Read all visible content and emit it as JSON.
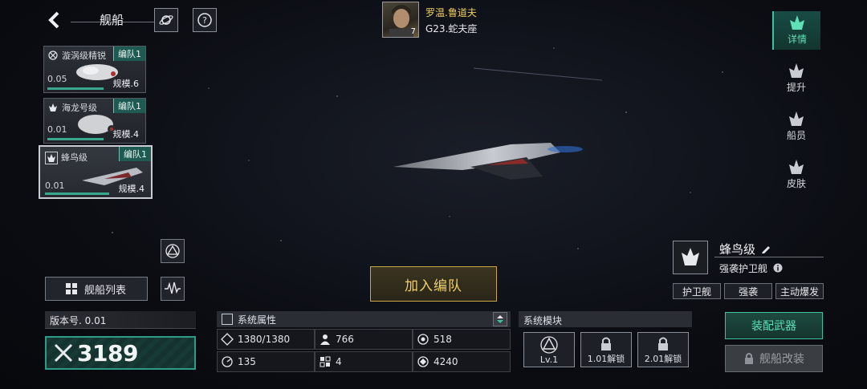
{
  "header": {
    "title": "舰船"
  },
  "commander": {
    "name": "罗温.鲁道夫",
    "location": "G23.蛇夫座",
    "level": "7"
  },
  "ship_cards": [
    {
      "name": "漩涡级精锐",
      "tag": "编队1",
      "version": "0.05",
      "scale": "规模.6"
    },
    {
      "name": "海龙号级",
      "tag": "编队1",
      "version": "0.01",
      "scale": "规模.4"
    },
    {
      "name": "蜂鸟级",
      "tag": "编队1",
      "version": "0.01",
      "scale": "规模.4"
    }
  ],
  "ship_list_label": "舰船列表",
  "version_label": "版本号. 0.01",
  "combat_power": "3189",
  "join_label": "加入编队",
  "system_attr": {
    "title": "系统属性",
    "cells": [
      {
        "icon": "armor-icon",
        "value": "1380/1380"
      },
      {
        "icon": "crew-icon",
        "value": "766"
      },
      {
        "icon": "shield-icon",
        "value": "518"
      },
      {
        "icon": "speed-icon",
        "value": "135"
      },
      {
        "icon": "flag-icon",
        "value": "4"
      },
      {
        "icon": "radar-icon",
        "value": "4240"
      }
    ]
  },
  "system_module": {
    "title": "系统模块",
    "slots": [
      {
        "label": "Lv.1"
      },
      {
        "label": "1.01解锁"
      },
      {
        "label": "2.01解锁"
      }
    ]
  },
  "ship_info": {
    "name": "蜂鸟级",
    "type": "强袭护卫舰",
    "tags": [
      "护卫舰",
      "强袭",
      "主动爆发"
    ]
  },
  "equip_weapon_label": "装配武器",
  "ship_modify_label": "舰船改装",
  "right_nav": [
    {
      "label": "详情",
      "active": true
    },
    {
      "label": "提升",
      "active": false
    },
    {
      "label": "船员",
      "active": false
    },
    {
      "label": "皮肤",
      "active": false
    }
  ],
  "colors": {
    "accent": "#3cc2a0",
    "gold": "#f0cf6a",
    "commander_name": "#f0d060"
  }
}
